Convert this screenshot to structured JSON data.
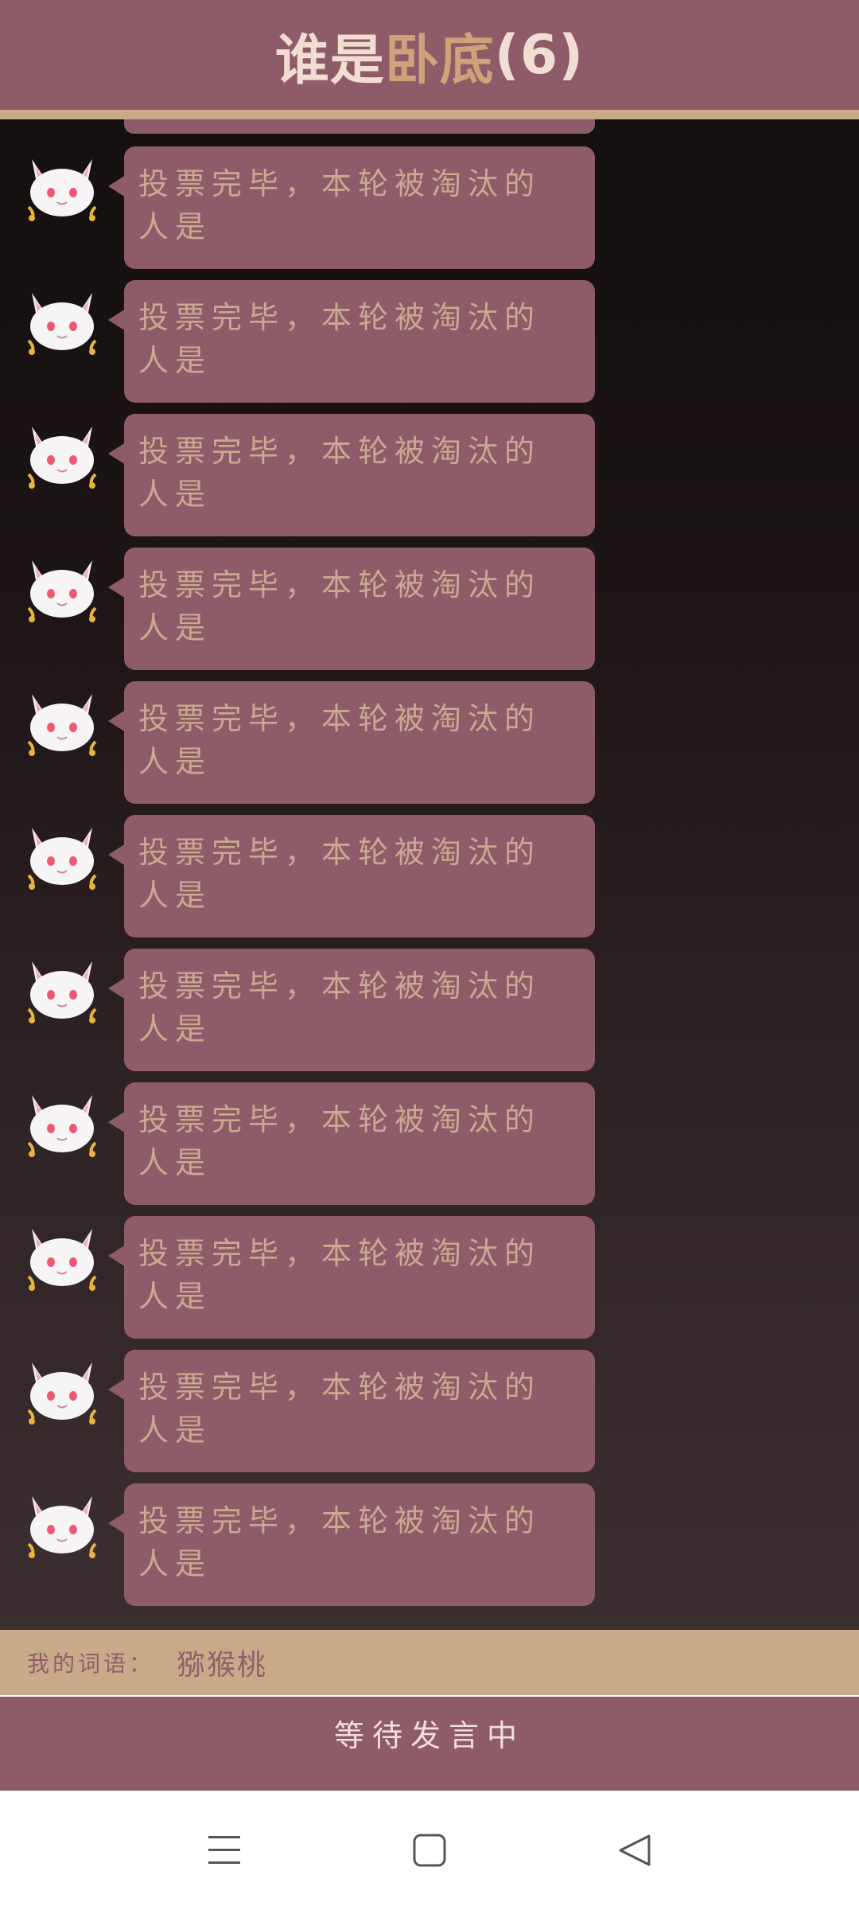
{
  "header": {
    "title_part1": "谁是",
    "title_part2": "卧底",
    "title_part3": "(6)"
  },
  "messages": [
    {
      "text": "投票完毕，本轮被淘汰的人是"
    },
    {
      "text": "投票完毕，本轮被淘汰的人是"
    },
    {
      "text": "投票完毕，本轮被淘汰的人是"
    },
    {
      "text": "投票完毕，本轮被淘汰的人是"
    },
    {
      "text": "投票完毕，本轮被淘汰的人是"
    },
    {
      "text": "投票完毕，本轮被淘汰的人是"
    },
    {
      "text": "投票完毕，本轮被淘汰的人是"
    },
    {
      "text": "投票完毕，本轮被淘汰的人是"
    },
    {
      "text": "投票完毕，本轮被淘汰的人是"
    },
    {
      "text": "投票完毕，本轮被淘汰的人是"
    },
    {
      "text": "投票完毕，本轮被淘汰的人是"
    }
  ],
  "word_bar": {
    "label": "我的词语：",
    "value": "猕猴桃"
  },
  "status": {
    "text": "等待发言中"
  },
  "icons": {
    "avatar": "white-cat-avatar-icon",
    "nav_menu": "menu-icon",
    "nav_home": "home-square-icon",
    "nav_back": "back-triangle-icon"
  },
  "colors": {
    "header_bg": "#8e5b69",
    "title_accent": "#cfa27a",
    "bubble_bg": "#8e5b69",
    "bubble_text": "#c9a991",
    "word_bar_bg": "#c7ab88"
  }
}
